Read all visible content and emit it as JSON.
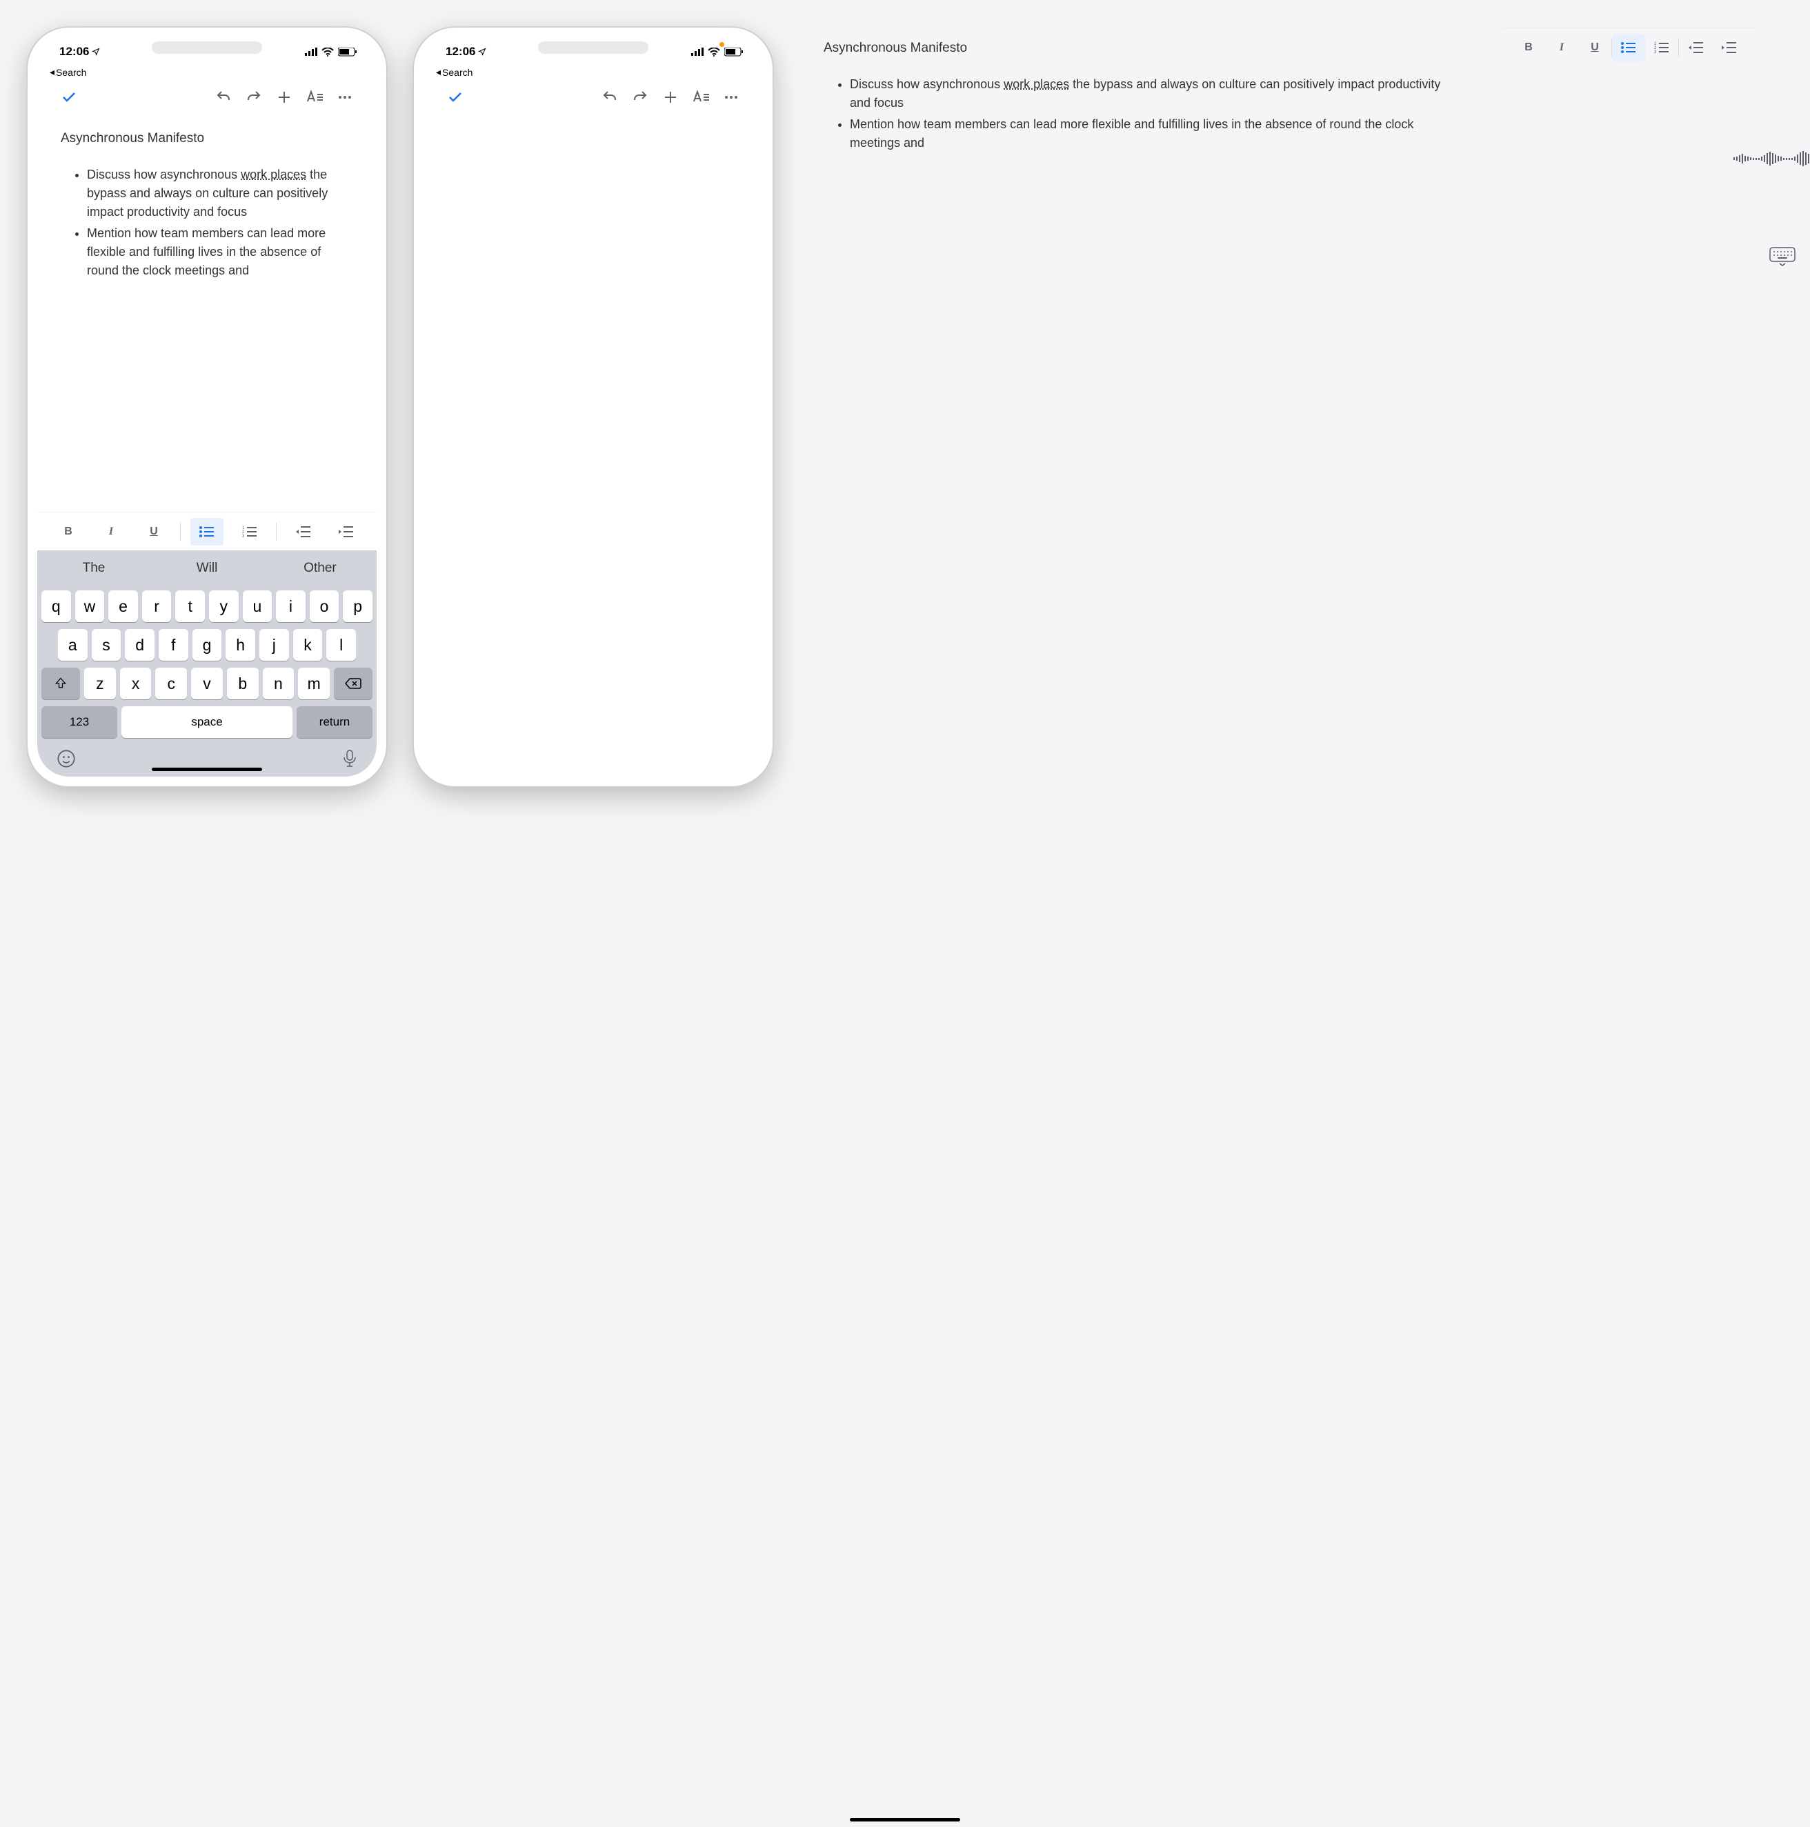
{
  "status": {
    "time": "12:06",
    "back_label": "Search"
  },
  "document": {
    "title": "Asynchronous Manifesto",
    "bullets": [
      {
        "pre": "Discuss how asynchronous ",
        "underlined": "work places",
        "post": " the bypass and always on culture can positively impact productivity and focus"
      },
      {
        "pre": "Mention how team members can lead more flexible and fulfilling lives in the absence of round the clock meetings and",
        "underlined": "",
        "post": ""
      }
    ]
  },
  "format_toolbar": {
    "bold": "B",
    "italic": "I",
    "underline": "U"
  },
  "keyboard": {
    "suggestions": [
      "The",
      "Will",
      "Other"
    ],
    "row1": [
      "q",
      "w",
      "e",
      "r",
      "t",
      "y",
      "u",
      "i",
      "o",
      "p"
    ],
    "row2": [
      "a",
      "s",
      "d",
      "f",
      "g",
      "h",
      "j",
      "k",
      "l"
    ],
    "row3": [
      "z",
      "x",
      "c",
      "v",
      "b",
      "n",
      "m"
    ],
    "numbers_key": "123",
    "space_key": "space",
    "return_key": "return"
  }
}
